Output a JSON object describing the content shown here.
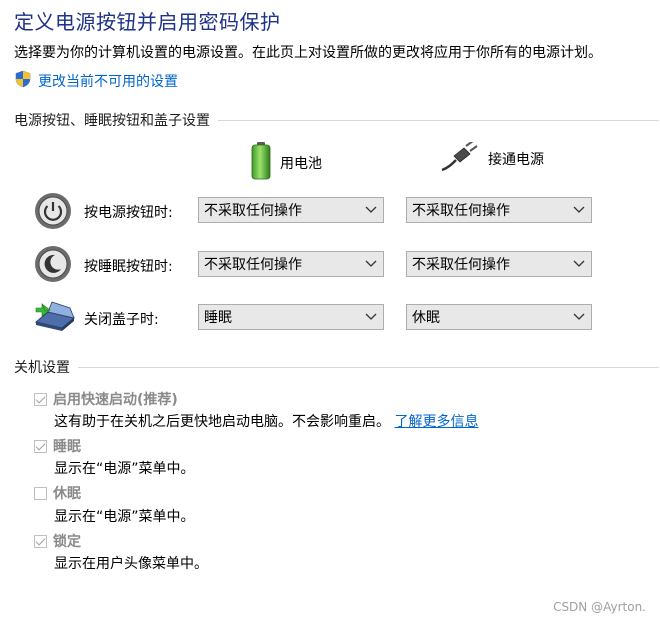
{
  "page": {
    "title": "定义电源按钮并启用密码保护",
    "description": "选择要为你的计算机设置的电源设置。在此页上对设置所做的更改将应用于你所有的电源计划。",
    "admin_link": "更改当前不可用的设置"
  },
  "power_buttons": {
    "section_title": "电源按钮、睡眠按钮和盖子设置",
    "columns": {
      "battery": "用电池",
      "plugged_in": "接通电源"
    },
    "rows": [
      {
        "label": "按电源按钮时:",
        "battery": "不采取任何操作",
        "plugged_in": "不采取任何操作"
      },
      {
        "label": "按睡眠按钮时:",
        "battery": "不采取任何操作",
        "plugged_in": "不采取任何操作"
      },
      {
        "label": "关闭盖子时:",
        "battery": "睡眠",
        "plugged_in": "休眠"
      }
    ]
  },
  "shutdown": {
    "section_title": "关机设置",
    "options": [
      {
        "label": "启用快速启动(推荐)",
        "checked": true,
        "desc": "这有助于在关机之后更快地启动电脑。不会影响重启。",
        "link": "了解更多信息"
      },
      {
        "label": "睡眠",
        "checked": true,
        "desc": "显示在“电源”菜单中。"
      },
      {
        "label": "休眠",
        "checked": false,
        "desc": "显示在“电源”菜单中。"
      },
      {
        "label": "锁定",
        "checked": true,
        "desc": "显示在用户头像菜单中。"
      }
    ]
  },
  "watermark": "CSDN @Ayrton."
}
